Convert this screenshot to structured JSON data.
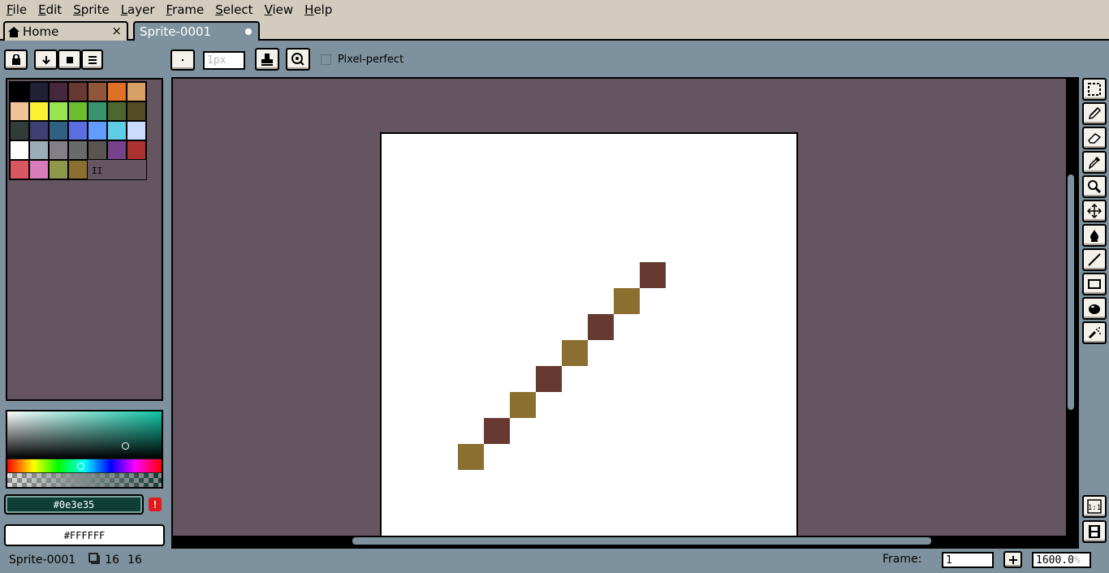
{
  "menubar": {
    "items": [
      {
        "underline": "F",
        "rest": "ile"
      },
      {
        "underline": "E",
        "rest": "dit"
      },
      {
        "underline": "S",
        "rest": "prite"
      },
      {
        "underline": "L",
        "rest": "ayer"
      },
      {
        "underline": "F",
        "rest": "rame"
      },
      {
        "underline": "S",
        "rest": "elect"
      },
      {
        "underline": "V",
        "rest": "iew"
      },
      {
        "underline": "H",
        "rest": "elp"
      }
    ]
  },
  "tabs": {
    "home_label": "Home",
    "home_close": "×",
    "sprite_label": "Sprite-0001"
  },
  "context_bar": {
    "brush_size_placeholder": "1px",
    "pixel_perfect_label": "Pixel-perfect",
    "pixel_perfect_checked": false
  },
  "palette": {
    "colors": [
      "#000000",
      "#222034",
      "#45283c",
      "#663931",
      "#8f563b",
      "#df7126",
      "#d9a066",
      "#eec39a",
      "#fbf236",
      "#99e550",
      "#6abe30",
      "#37946e",
      "#4b692f",
      "#524b24",
      "#323c39",
      "#3f3f74",
      "#306082",
      "#5b6ee1",
      "#639bff",
      "#5fcde4",
      "#cbdbfc",
      "#ffffff",
      "#9badb7",
      "#847e87",
      "#696a6a",
      "#595652",
      "#76428a",
      "#ac3232",
      "#d95763",
      "#d77bba",
      "#8f974a",
      "#8a6f30"
    ],
    "pause_glyph": "II"
  },
  "color_picker": {
    "foreground_hex": "#0e3e35",
    "background_hex": "#FFFFFF",
    "warning_glyph": "!"
  },
  "sprite": {
    "pixel_colors": [
      "#663931",
      "#8a6f30",
      "#663931",
      "#8a6f30",
      "#663931",
      "#8a6f30",
      "#663931",
      "#8a6f30"
    ]
  },
  "status": {
    "sprite_name": "Sprite-0001",
    "width": "16",
    "height": "16",
    "frame_label": "Frame:",
    "frame_value": "1",
    "zoom_value": "1600.0",
    "zoom_unit": "%"
  },
  "tools": [
    "marquee-icon",
    "pencil-icon",
    "eraser-icon",
    "eyedropper-icon",
    "zoom-icon",
    "move-icon",
    "paint-bucket-icon",
    "line-icon",
    "rectangle-icon",
    "ellipse-icon",
    "spray-icon"
  ]
}
